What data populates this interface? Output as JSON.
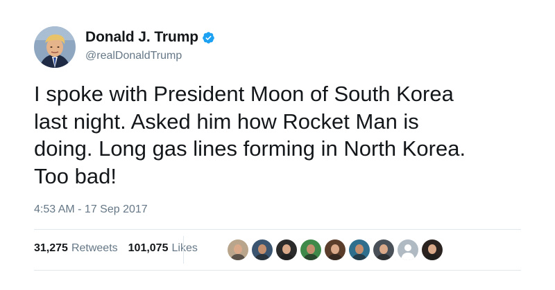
{
  "author": {
    "display_name": "Donald J. Trump",
    "handle": "@realDonaldTrump",
    "verified": true,
    "verified_color": "#1da1f2"
  },
  "tweet": {
    "text": "I spoke with President Moon of South Korea\nlast night. Asked him how Rocket Man is\ndoing. Long gas lines forming in North Korea.\nToo bad!",
    "timestamp": "4:53 AM - 17 Sep 2017"
  },
  "stats": {
    "retweets_count": "31,275",
    "retweets_label": "Retweets",
    "likes_count": "101,075",
    "likes_label": "Likes"
  },
  "likers": [
    {
      "icon": "user-avatar-1",
      "color": "#b8a58c"
    },
    {
      "icon": "user-avatar-2",
      "color": "#3b5570"
    },
    {
      "icon": "user-avatar-3",
      "color": "#2b2b2b"
    },
    {
      "icon": "user-avatar-4",
      "color": "#3f8a4a"
    },
    {
      "icon": "user-avatar-5",
      "color": "#5a3d2b"
    },
    {
      "icon": "user-avatar-6",
      "color": "#2e6f8e"
    },
    {
      "icon": "user-avatar-7",
      "color": "#4a5058"
    },
    {
      "icon": "default-avatar",
      "color": "#b0bac3"
    },
    {
      "icon": "user-avatar-9",
      "color": "#2a2320"
    }
  ]
}
